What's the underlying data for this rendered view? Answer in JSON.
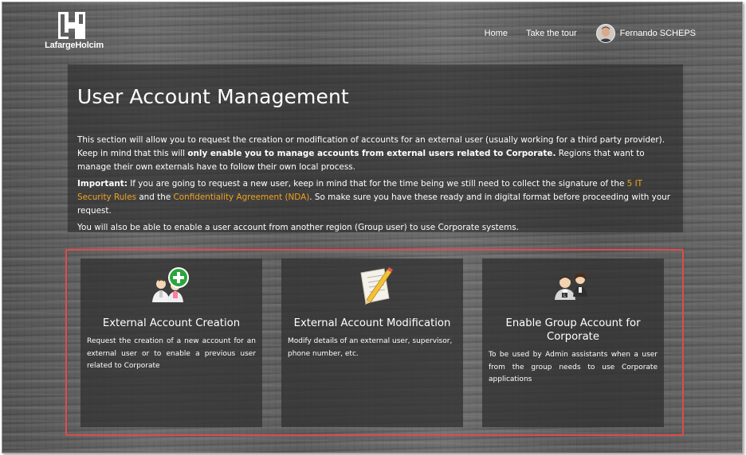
{
  "header": {
    "logo_text": "LafargeHolcim",
    "nav": {
      "home": "Home",
      "tour": "Take the tour"
    },
    "user_name": "Fernando SCHEPS"
  },
  "intro": {
    "title": "User Account Management",
    "p1_a": "This section will allow you to request the creation or modification of accounts for an external user (usually working for a third party provider). Keep in mind that this will ",
    "p1_bold": "only enable you to manage accounts from external users related to Corporate.",
    "p1_b": " Regions that want to manage their own externals have to follow their own local process.",
    "p2_label": "Important:",
    "p2_a": " If you are going to request a new user, keep in mind that for the time being we still need to collect the signature of the ",
    "p2_link1": "5 IT Security Rules",
    "p2_b": " and the ",
    "p2_link2": "Confidentiality Agreement (NDA)",
    "p2_c": ". So make sure you have these ready and in digital format before proceeding with your request.",
    "p3": "You will also be able to enable a user account from another region (Group user) to use Corporate systems."
  },
  "cards": [
    {
      "title": "External Account Creation",
      "desc": "Request the creation of a new account for an external user or to enable a previous user related to Corporate",
      "icon": "add-users-icon"
    },
    {
      "title": "External Account Modification",
      "desc": "Modify details of an external user, supervisor, phone number, etc.",
      "icon": "edit-document-icon"
    },
    {
      "title": "Enable Group Account for Corporate",
      "desc": "To be used by Admin assistants when a user from the group needs to use Corporate applications",
      "icon": "group-users-icon"
    }
  ],
  "colors": {
    "link": "#f0a21f",
    "highlight_border": "#e04b4b"
  }
}
